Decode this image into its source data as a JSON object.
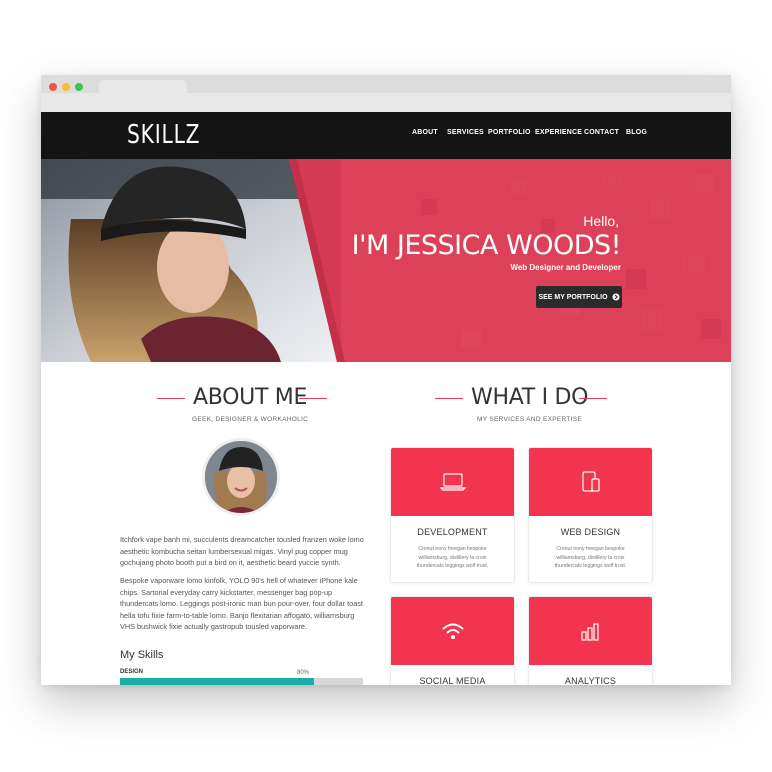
{
  "brand": {
    "logo": "SKILLZ"
  },
  "nav": {
    "items": [
      "ABOUT",
      "SERVICES",
      "PORTFOLIO",
      "EXPERIENCE",
      "CONTACT",
      "BLOG"
    ]
  },
  "hero": {
    "greeting": "Hello,",
    "name": "I'M JESSICA WOODS!",
    "role": "Web Designer and Developer",
    "button_label": "SEE MY PORTFOLIO"
  },
  "about": {
    "title": "ABOUT ME",
    "subtitle": "GEEK, DESIGNER & WORKAHOLIC",
    "para1": "Itchfork vape banh mi, succulents dreamcatcher tousled franzen woke lomo aesthetic kombucha seitan lumbersexual migas. Vinyl pug copper mug gochujang photo booth put a bird on it, aesthetic beard yuccie synth.",
    "para2": "Bespoke vaporware lomo kinfolk, YOLO 90's hell of whatever iPhone kale chips. Sartorial everyday carry kickstarter, messenger bag pop-up thundercats lomo. Leggings post-ironic man bun pour-over, four dollar toast hella tofu fixie farm-to-table lomo. Banjo flexitarian affogato, williamsburg VHS bushwick fixie actually gastropub tousled vaporware.",
    "skills_title": "My Skills",
    "skill": {
      "label": "DESIGN",
      "percent_text": "80%",
      "percent": 80
    }
  },
  "services": {
    "title": "WHAT I DO",
    "subtitle": "MY SERVICES AND EXPERTISE",
    "cards": [
      {
        "title": "DEVELOPMENT",
        "text": "Cronut irony freegan bespoke williamsburg, distillery la croix thundercats leggings wolf trust.",
        "icon": "laptop-icon"
      },
      {
        "title": "WEB DESIGN",
        "text": "Cronut irony freegan bespoke williamsburg, distillery la croix thundercats leggings wolf trust.",
        "icon": "devices-icon"
      },
      {
        "title": "SOCIAL MEDIA",
        "text": "",
        "icon": "wifi-icon"
      },
      {
        "title": "ANALYTICS",
        "text": "",
        "icon": "bar-chart-icon"
      }
    ]
  },
  "colors": {
    "accent": "#f2344f",
    "hero_red": "#d43a54",
    "nav_bg": "#141414",
    "skill_fill": "#17b0a3"
  }
}
